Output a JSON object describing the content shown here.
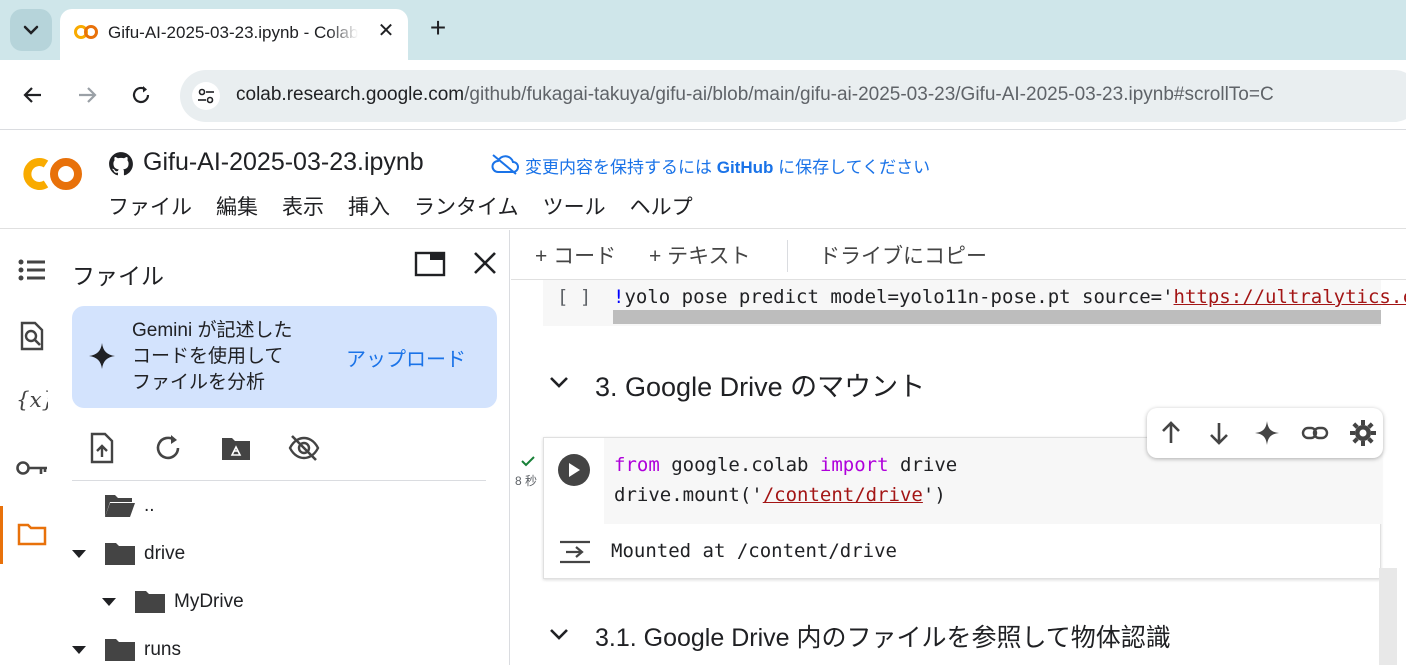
{
  "browser": {
    "tab_title": "Gifu-AI-2025-03-23.ipynb - Colab",
    "url_host": "colab.research.google.com",
    "url_path": "/github/fukagai-takuya/gifu-ai/blob/main/gifu-ai-2025-03-23/Gifu-AI-2025-03-23.ipynb#scrollTo=C",
    "new_tab": "+",
    "close_tab": "✕"
  },
  "colab": {
    "notebook_title": "Gifu-AI-2025-03-23.ipynb",
    "save_prefix": "変更内容を保持するには ",
    "save_github": "GitHub",
    "save_suffix": " に保存してください",
    "menu": [
      "ファイル",
      "編集",
      "表示",
      "挿入",
      "ランタイム",
      "ツール",
      "ヘルプ"
    ]
  },
  "files_panel": {
    "title": "ファイル",
    "gemini_text": "Gemini が記述したコードを使用してファイルを分析",
    "gemini_line1": "Gemini が記述した",
    "gemini_line2": "コードを使用して",
    "gemini_line3": "ファイルを分析",
    "upload_link": "アップロード",
    "tree": [
      {
        "label": "..",
        "depth": 1,
        "expanded": false
      },
      {
        "label": "drive",
        "depth": 0,
        "expanded": true
      },
      {
        "label": "MyDrive",
        "depth": 1,
        "expanded": true
      },
      {
        "label": "runs",
        "depth": 0,
        "expanded": true
      }
    ]
  },
  "notebook": {
    "toolbar": {
      "add_code": "+ コード",
      "add_text": "+ テキスト",
      "copy_drive": "ドライブにコピー"
    },
    "cell1": {
      "brackets": "[ ]",
      "bang": "!",
      "code_prefix": "yolo pose predict model=yolo11n-pose.pt source='",
      "code_url": "https://ultralytics.com/"
    },
    "section1": "3. Google Drive のマウント",
    "cell2": {
      "status_time": "8 秒",
      "line1_kw1": "from",
      "line1_mid": " google.colab ",
      "line1_kw2": "import",
      "line1_end": " drive",
      "line2_prefix": "drive.mount('",
      "line2_str": "/content/drive",
      "line2_suffix": "')",
      "output": "Mounted at /content/drive"
    },
    "section2": "3.1. Google Drive 内のファイルを参照して物体認識"
  },
  "colors": {
    "accent_blue": "#1a73e8",
    "colab_orange": "#f9ab00",
    "active_rail": "#e8710a",
    "gemini_bg": "#d3e3fd"
  }
}
